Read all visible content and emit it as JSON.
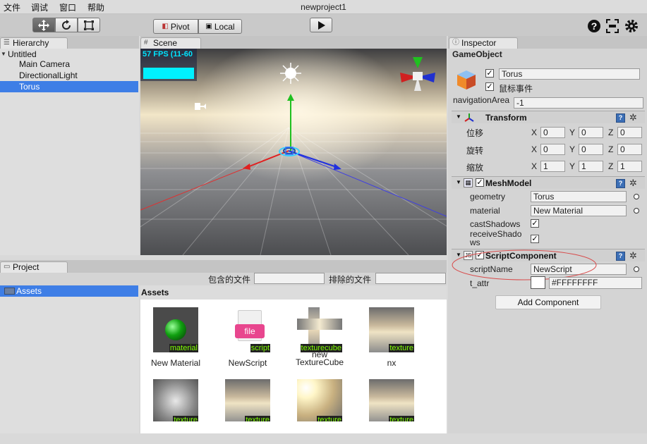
{
  "menu": {
    "items": [
      "文件",
      "调试",
      "窗口",
      "帮助"
    ],
    "app_title": "newproject1"
  },
  "toolbar": {
    "pivot_label": "Pivot",
    "local_label": "Local"
  },
  "hierarchy": {
    "tab": "Hierarchy",
    "items": [
      {
        "label": "Untitled",
        "indent": 0,
        "expander": "▼"
      },
      {
        "label": "Main Camera",
        "indent": 1
      },
      {
        "label": "DirectionalLight",
        "indent": 1
      },
      {
        "label": "Torus",
        "indent": 1,
        "selected": true
      }
    ]
  },
  "scene": {
    "tab": "Scene",
    "fps": "57 FPS (11-60"
  },
  "inspector": {
    "tab": "Inspector",
    "header": "GameObject",
    "name_value": "Torus",
    "mouse_event_label": "鼠标事件",
    "nav_label": "navigationArea",
    "nav_value": "-1",
    "transform": {
      "title": "Transform",
      "rows": [
        {
          "label": "位移",
          "x": "0",
          "y": "0",
          "z": "0"
        },
        {
          "label": "旋转",
          "x": "0",
          "y": "0",
          "z": "0"
        },
        {
          "label": "缩放",
          "x": "1",
          "y": "1",
          "z": "1"
        }
      ],
      "axes": [
        "X",
        "Y",
        "Z"
      ]
    },
    "mesh": {
      "title": "MeshModel",
      "geometry_label": "geometry",
      "geometry_value": "Torus",
      "material_label": "material",
      "material_value": "New Material",
      "cast_label": "castShadows",
      "receive_label": "receiveShadows"
    },
    "script": {
      "title": "ScriptComponent",
      "script_label": "scriptName",
      "script_value": "NewScript",
      "attr_label": "t_attr",
      "attr_value": "#FFFFFFFF"
    },
    "add_component": "Add Component"
  },
  "project": {
    "tab": "Project",
    "include_label": "包含的文件",
    "exclude_label": "排除的文件",
    "tree_item": "Assets",
    "assets_header": "Assets",
    "assets": [
      {
        "tag": "material",
        "name": "New Material",
        "kind": "sphere"
      },
      {
        "tag": "script",
        "name": "NewScript",
        "kind": "file"
      },
      {
        "tag": "texturecube",
        "name": "new TextureCube",
        "kind": "cross"
      },
      {
        "tag": "texture",
        "name": "nx",
        "kind": "sky"
      },
      {
        "tag": "texture",
        "name": "",
        "kind": "cloud"
      },
      {
        "tag": "texture",
        "name": "",
        "kind": "sky"
      },
      {
        "tag": "texture",
        "name": "",
        "kind": "sun"
      },
      {
        "tag": "texture",
        "name": "",
        "kind": "sky"
      }
    ],
    "file_icon_text": "file"
  },
  "colors": {
    "selection": "#3e7ee6",
    "fps": "#00e5ff",
    "tag_text": "#7fff00"
  }
}
